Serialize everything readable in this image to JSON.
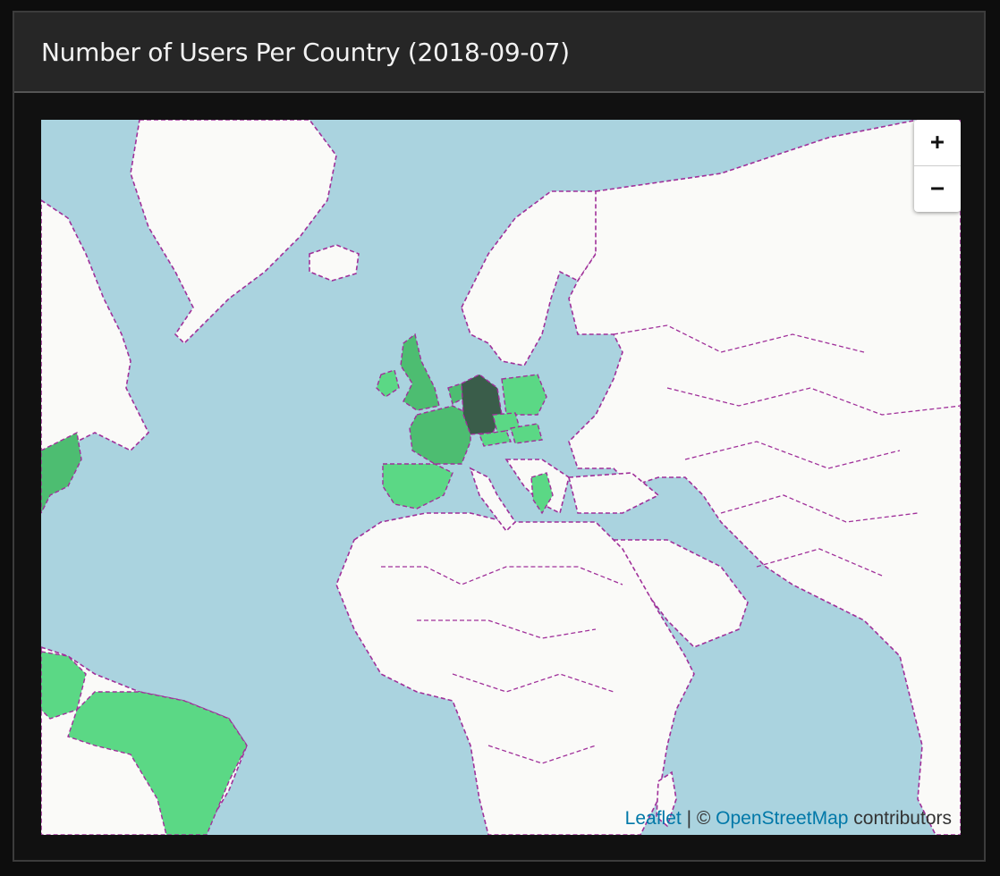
{
  "panel": {
    "title": "Number of Users Per Country (2018-09-07)"
  },
  "map": {
    "water_color": "#aad3df",
    "land_color": "#fafaf8",
    "border_color": "#a0309a",
    "choropleth": {
      "color_light": "#5bd885",
      "color_medium": "#4dbd71",
      "color_dark": "#3a5d4a",
      "highlighted_regions": [
        {
          "region": "Germany",
          "level": "dark"
        },
        {
          "region": "United Kingdom",
          "level": "medium"
        },
        {
          "region": "Ireland",
          "level": "light"
        },
        {
          "region": "France",
          "level": "medium"
        },
        {
          "region": "Spain",
          "level": "light"
        },
        {
          "region": "Poland",
          "level": "light"
        },
        {
          "region": "Netherlands",
          "level": "medium"
        },
        {
          "region": "Czech Republic",
          "level": "light"
        },
        {
          "region": "Austria",
          "level": "light"
        },
        {
          "region": "Hungary",
          "level": "light"
        },
        {
          "region": "Greece",
          "level": "light"
        },
        {
          "region": "Brazil",
          "level": "light"
        },
        {
          "region": "Venezuela",
          "level": "light"
        },
        {
          "region": "Eastern USA",
          "level": "medium"
        }
      ]
    },
    "zoom_in_label": "+",
    "zoom_out_label": "−",
    "attribution": {
      "leaflet": "Leaflet",
      "separator": " | © ",
      "osm": "OpenStreetMap",
      "suffix": " contributors"
    }
  }
}
